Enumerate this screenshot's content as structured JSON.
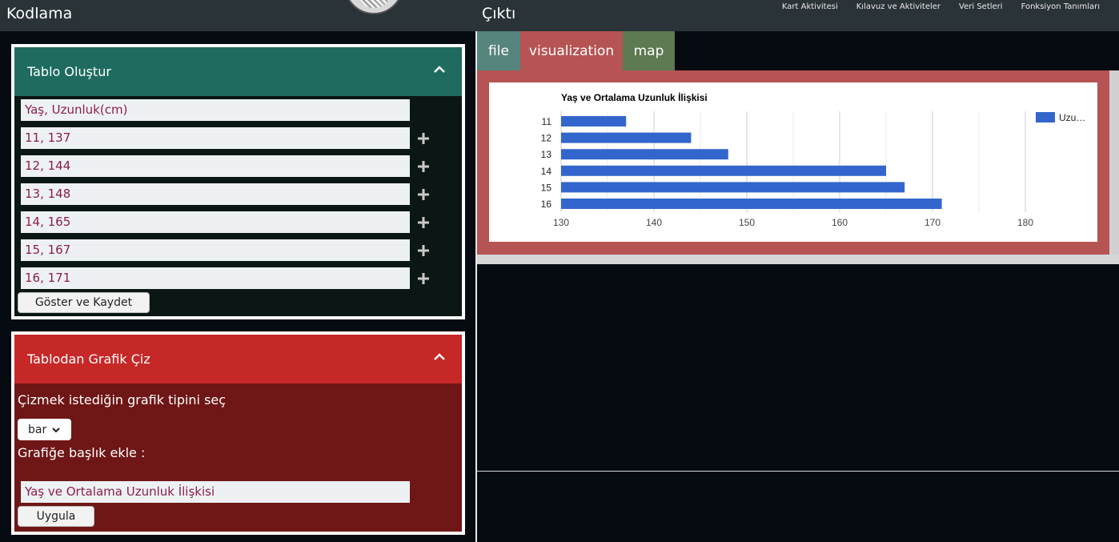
{
  "header": {
    "left_title": "Kodlama",
    "right_title": "Çıktı",
    "nav": [
      "Kart Aktivitesi",
      "Kılavuz ve Aktiviteler",
      "Veri Setleri",
      "Fonksiyon Tanımları"
    ]
  },
  "table_panel": {
    "title": "Tablo Oluştur",
    "rows": [
      "Yaş, Uzunluk(cm)",
      "11, 137",
      "12, 144",
      "13, 148",
      "14, 165",
      "15, 167",
      "16, 171"
    ],
    "save_button": "Göster ve Kaydet"
  },
  "graph_panel": {
    "title": "Tablodan Grafik Çiz",
    "chart_type_label": "Çizmek istediğin grafik tipini seç",
    "chart_type_value": "bar",
    "title_label": "Grafiğe başlık ekle :",
    "title_input": "Yaş ve Ortalama Uzunluk İlişkisi",
    "apply_button": "Uygula"
  },
  "output": {
    "tabs": [
      "file",
      "visualization",
      "map"
    ],
    "active_tab": "visualization"
  },
  "colors": {
    "bar": "#3366cc",
    "table_header": "#1f6b60",
    "graph_header": "#c62828",
    "vis_tab": "#b55453"
  },
  "chart_data": {
    "type": "bar",
    "orientation": "horizontal",
    "title": "Yaş ve Ortalama Uzunluk İlişkisi",
    "categories": [
      "11",
      "12",
      "13",
      "14",
      "15",
      "16"
    ],
    "series": [
      {
        "name": "Uzu…",
        "values": [
          137,
          144,
          148,
          165,
          167,
          171
        ]
      }
    ],
    "xlim": [
      130,
      180
    ],
    "x_ticks": [
      "130",
      "140",
      "150",
      "160",
      "170",
      "180"
    ],
    "legend": "right",
    "grid": true
  }
}
